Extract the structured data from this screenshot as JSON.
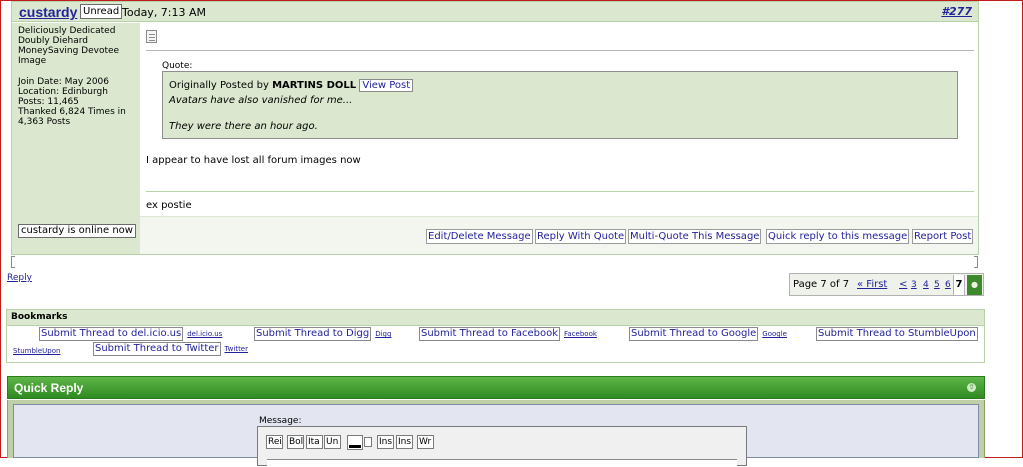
{
  "post": {
    "username": "custardy",
    "unread": "Unread",
    "date": "Today, 7:13 AM",
    "number": "#277",
    "user_titles": [
      "Deliciously Dedicated",
      "Doubly Diehard",
      "MoneySaving Devotee",
      "Image"
    ],
    "stats": {
      "join": "Join Date: May 2006",
      "location": "Location: Edinburgh",
      "posts": "Posts: 11,465",
      "thanked_1": "Thanked 6,824 Times in",
      "thanked_2": "4,363 Posts"
    },
    "online_status": "custardy is online now",
    "quote": {
      "label": "Quote:",
      "originally": "Originally Posted by",
      "author": "MARTINS DOLL",
      "view_post": "View Post",
      "line1": "Avatars have also vanished for me...",
      "line2": "They were there an hour ago."
    },
    "message": "I appear to have lost all forum images now",
    "signature": "ex postie",
    "actions": {
      "edit": "Edit/Delete Message",
      "reply_quote": "Reply With Quote",
      "multi_quote": "Multi-Quote This Message",
      "quick_reply": "Quick reply to this message",
      "report": "Report Post"
    }
  },
  "reply_link": "Reply",
  "pagenav": {
    "label": "Page 7 of 7",
    "first": "« First",
    "prev": "<",
    "pages": [
      "3",
      "4",
      "5",
      "6"
    ],
    "current": "7",
    "next_icon": "green-arrow-icon"
  },
  "bookmarks": {
    "title": "Bookmarks",
    "items": [
      {
        "label": "Submit Thread to del.icio.us",
        "tag": "del.icio.us"
      },
      {
        "label": "Submit Thread to Digg",
        "tag": "Digg"
      },
      {
        "label": "Submit Thread to Facebook",
        "tag": "Facebook"
      },
      {
        "label": "Submit Thread to Google",
        "tag": "Google"
      },
      {
        "label": "Submit Thread to StumbleUpon",
        "tag": "StumbleUpon"
      },
      {
        "label": "Submit Thread to Twitter",
        "tag": "Twitter"
      }
    ]
  },
  "quick_reply": {
    "title": "Quick Reply",
    "message_label": "Message:",
    "toolbar": [
      "Rei",
      "Bol",
      "Ita",
      "Un",
      "Ins",
      "Ins",
      "Wr"
    ]
  },
  "colors": {
    "accent_green": "#2e8a21",
    "post_panel": "#dbe8cf",
    "link_blue": "#22229c"
  }
}
